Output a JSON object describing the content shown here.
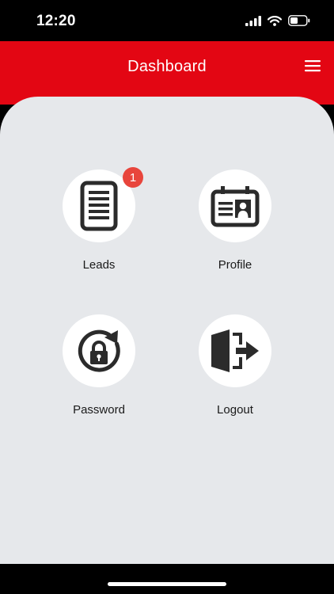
{
  "status_bar": {
    "time": "12:20"
  },
  "header": {
    "title": "Dashboard"
  },
  "tiles": [
    {
      "label": "Leads",
      "icon": "document-list-icon",
      "badge": "1"
    },
    {
      "label": "Profile",
      "icon": "id-card-icon"
    },
    {
      "label": "Password",
      "icon": "lock-reset-icon"
    },
    {
      "label": "Logout",
      "icon": "logout-door-icon"
    }
  ],
  "colors": {
    "brand_red": "#e30613",
    "background": "#e6e8eb",
    "badge_red": "#e8453c",
    "icon_dark": "#2b2b2b"
  }
}
